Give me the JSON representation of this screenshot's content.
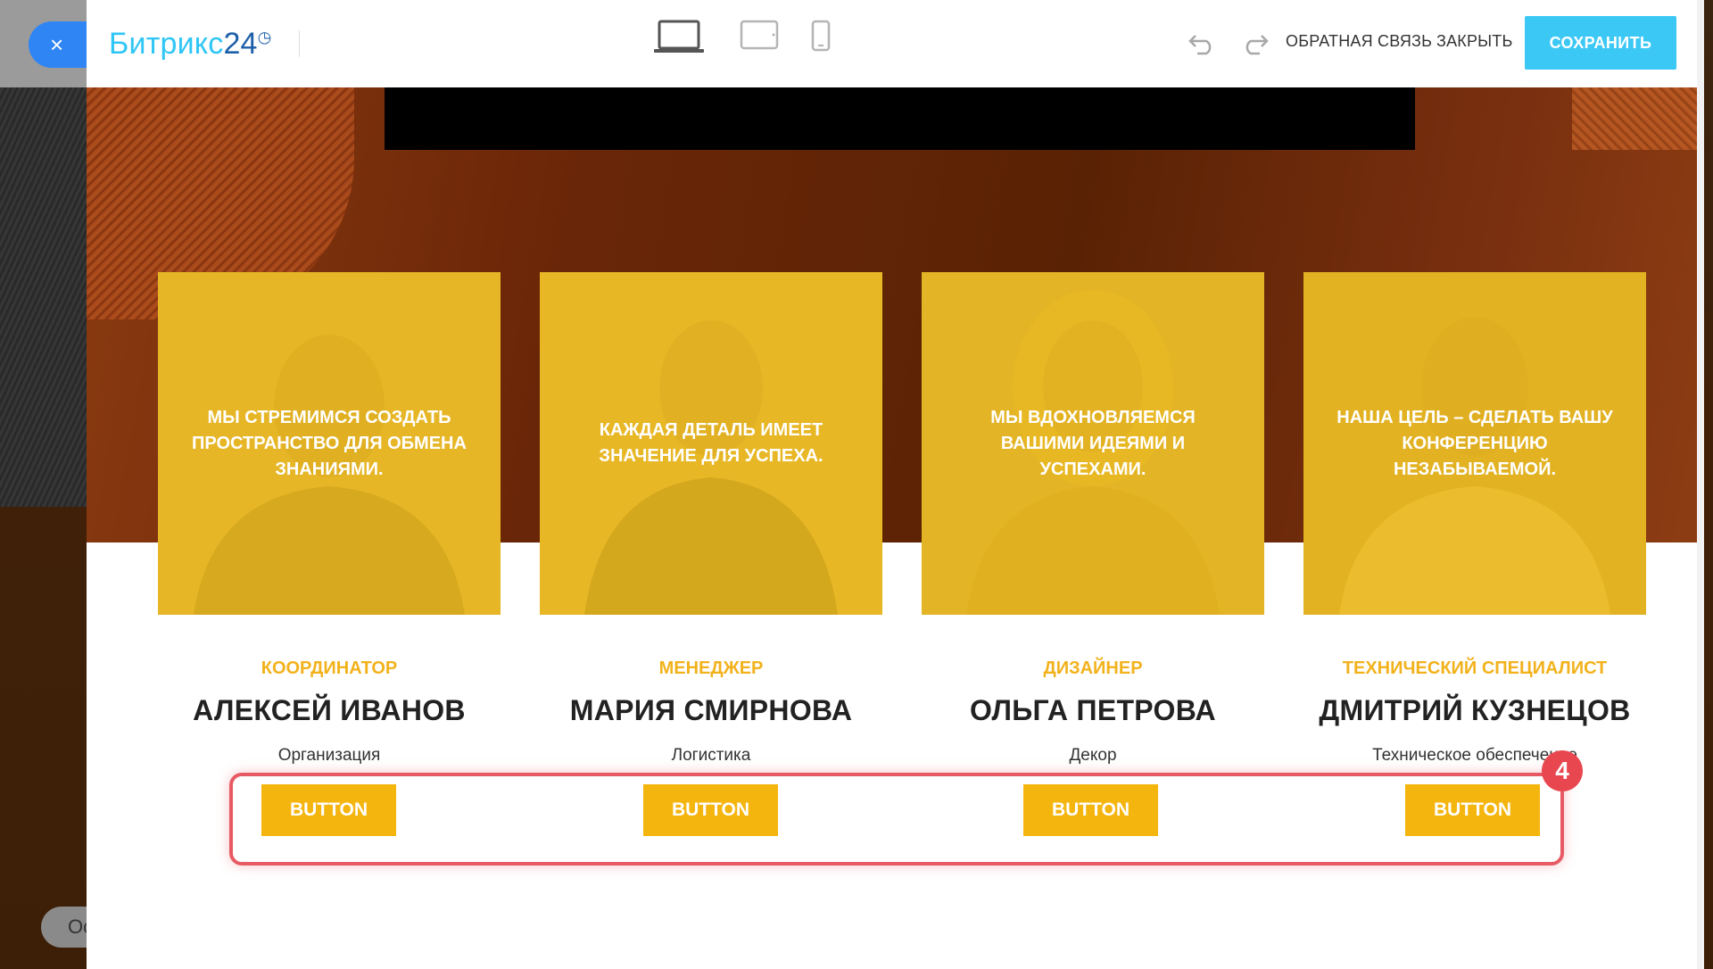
{
  "app": {
    "logo_text": "Битрикс",
    "logo_num": "24",
    "close_symbol": "×",
    "background_pill_text": "Ос"
  },
  "toolbar": {
    "feedback_label": "ОБРАТНАЯ СВЯЗЬ",
    "close_label": "ЗАКРЫТЬ",
    "save_label": "СОХРАНИТЬ",
    "devices": [
      "laptop-icon",
      "tablet-icon",
      "phone-icon"
    ],
    "accent_color": "#3bc8f5"
  },
  "team": [
    {
      "quote": "МЫ СТРЕМИМСЯ СОЗДАТЬ ПРОСТРАНСТВО ДЛЯ ОБМЕНА ЗНАНИЯМИ.",
      "role": "КООРДИНАТОР",
      "name": "АЛЕКСЕЙ ИВАНОВ",
      "department": "Организация",
      "button": "BUTTON"
    },
    {
      "quote": "КАЖДАЯ ДЕТАЛЬ ИМЕЕТ ЗНАЧЕНИЕ ДЛЯ УСПЕХА.",
      "role": "МЕНЕДЖЕР",
      "name": "МАРИЯ СМИРНОВА",
      "department": "Логистика",
      "button": "BUTTON"
    },
    {
      "quote": "МЫ ВДОХНОВЛЯЕМСЯ ВАШИМИ ИДЕЯМИ И УСПЕХАМИ.",
      "role": "ДИЗАЙНЕР",
      "name": "ОЛЬГА ПЕТРОВА",
      "department": "Декор",
      "button": "BUTTON"
    },
    {
      "quote": "НАША ЦЕЛЬ – СДЕЛАТЬ ВАШУ КОНФЕРЕНЦИЮ НЕЗАБЫВАЕМОЙ.",
      "role": "ТЕХНИЧЕСКИЙ СПЕЦИАЛИСТ",
      "name": "ДМИТРИЙ КУЗНЕЦОВ",
      "department": "Техническое обеспечение",
      "button": "BUTTON"
    }
  ],
  "annotation": {
    "marker_number": "4",
    "highlight_color": "#e85a63"
  },
  "colors": {
    "card_overlay": "#ecba1c",
    "role_text": "#f2b21c",
    "button_bg": "#f5b50f"
  }
}
